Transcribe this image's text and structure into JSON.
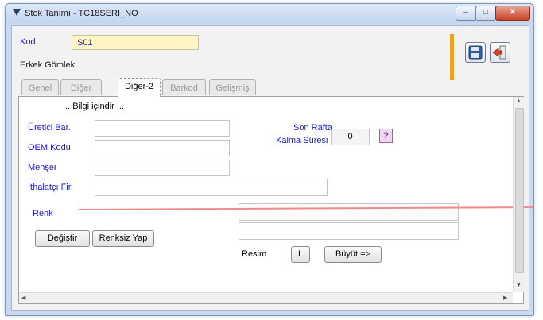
{
  "window": {
    "title": "Stok Tanımı - TC18SERI_NO",
    "minimize_glyph": "‒",
    "maximize_glyph": "□",
    "close_glyph": "✕"
  },
  "header": {
    "kod_label": "Kod",
    "kod_value": "S01",
    "description": "Erkek Gömlek"
  },
  "toolbar": {
    "save_icon": "save-icon",
    "exit_icon": "exit-door-icon"
  },
  "tabs": [
    {
      "label": "Genel",
      "active": false
    },
    {
      "label": "Diğer",
      "active": false
    },
    {
      "label": "Diğer-2",
      "active": true
    },
    {
      "label": "Barkod",
      "active": false
    },
    {
      "label": "Gelişmiş",
      "active": false
    }
  ],
  "panel": {
    "info_text": "... Bilgi içindir ...",
    "uretici_label": "Üretici Bar.",
    "oem_label": "OEM Kodu",
    "mensei_label": "Menşei",
    "ithalatci_label": "İthalatçı Fir.",
    "son_rafta_label": "Son Rafta",
    "kalma_suresi_label": "Kalma Süresi",
    "kalma_suresi_value": "0",
    "help_label": "?",
    "renk_label": "Renk",
    "degistir_label": "Değiştir",
    "renksiz_label": "Renksiz Yap",
    "resim_label": "Resim",
    "l_label": "L",
    "buyut_label": "Büyüt =>"
  },
  "colors": {
    "label_blue": "#1a1ad0",
    "kod_field_bg": "#fdf5c4",
    "accent_orange": "#e8a321",
    "close_red": "#c9442a"
  }
}
